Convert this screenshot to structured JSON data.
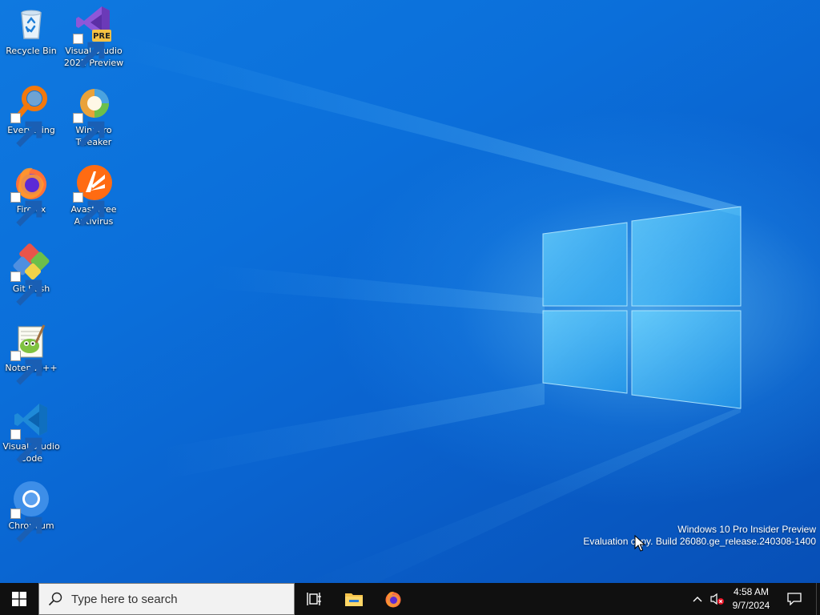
{
  "desktop": {
    "icons": [
      {
        "label": "Recycle Bin",
        "icon": "recycle-bin-icon"
      },
      {
        "label": "Visual Studio 2022 Preview",
        "icon": "visual-studio-preview-icon",
        "badge": "PRE"
      },
      {
        "label": "Everything",
        "icon": "everything-search-icon"
      },
      {
        "label": "Winaero Tweaker",
        "icon": "winaero-tweaker-icon"
      },
      {
        "label": "Firefox",
        "icon": "firefox-icon"
      },
      {
        "label": "Avast Free Antivirus",
        "icon": "avast-icon"
      },
      {
        "label": "Git Bash",
        "icon": "git-bash-icon"
      },
      {
        "label": "Notepad++",
        "icon": "notepad-plus-plus-icon"
      },
      {
        "label": "Visual Studio Code",
        "icon": "vscode-icon"
      },
      {
        "label": "Chromium",
        "icon": "chromium-icon"
      }
    ],
    "watermark": {
      "line1": "Windows 10 Pro Insider Preview",
      "line2": "Evaluation copy. Build 26080.ge_release.240308-1400"
    }
  },
  "taskbar": {
    "start": {
      "icon": "windows-start-icon"
    },
    "search": {
      "placeholder": "Type here to search",
      "icon": "search-icon"
    },
    "pinned": [
      {
        "name": "Task View",
        "icon": "task-view-icon"
      },
      {
        "name": "File Explorer",
        "icon": "file-explorer-icon"
      },
      {
        "name": "Firefox",
        "icon": "firefox-icon"
      }
    ],
    "tray": {
      "chevron_icon": "chevron-up-icon",
      "volume_icon": "volume-muted-icon",
      "time": "4:58 AM",
      "date": "9/7/2024",
      "notification_icon": "action-center-icon"
    }
  },
  "colors": {
    "wallpaper": "#0a63cf",
    "taskbar": "#101010",
    "search_box": "#f2f2f2"
  }
}
